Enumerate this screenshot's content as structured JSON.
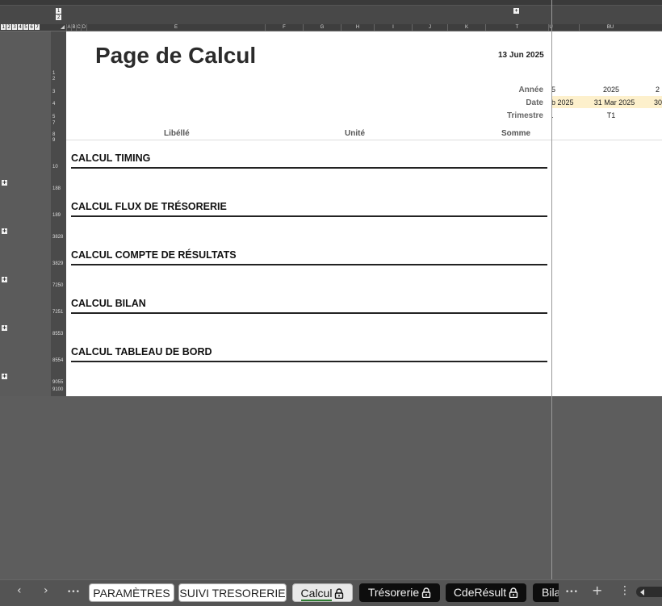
{
  "outline": {
    "top_levels": [
      "1",
      "2"
    ],
    "row_levels": [
      "1",
      "2",
      "3",
      "4",
      "5",
      "6",
      "7"
    ],
    "row_numbers": [
      "1",
      "2",
      "3",
      "4",
      "5",
      "7",
      "8",
      "9",
      "10",
      "188",
      "189",
      "3828",
      "3829",
      "7250",
      "7251",
      "8553",
      "8554",
      "9055",
      "9100"
    ]
  },
  "columns": [
    "A",
    "B",
    "C",
    "D",
    "E",
    "F",
    "G",
    "H",
    "I",
    "J",
    "K",
    "T",
    "U",
    "BU"
  ],
  "sheet": {
    "title": "Page de Calcul",
    "date": "13 Jun 2025",
    "labels": {
      "annee": "Année",
      "date": "Date",
      "trimestre": "Trimestre"
    },
    "headers": {
      "libelle": "Libéllé",
      "unite": "Unité",
      "somme": "Somme"
    },
    "periods": {
      "year_partial": "5",
      "year": "2025",
      "year_next": "2",
      "date_partial": "b 2025",
      "date": "31 Mar 2025",
      "date_next": "30",
      "quarter_partial": ".",
      "quarter": "T1"
    },
    "sections": [
      "CALCUL TIMING",
      "CALCUL FLUX DE TRÉSORERIE",
      "CALCUL COMPTE DE RÉSULTATS",
      "CALCUL BILAN",
      "CALCUL TABLEAU DE BORD"
    ]
  },
  "tabs": {
    "prev": "‹",
    "next": "›",
    "more": "•••",
    "items": [
      {
        "label": "PARAMÈTRES",
        "style": "light"
      },
      {
        "label": "SUIVI TRESORERIE",
        "style": "light"
      },
      {
        "label": "Calcul",
        "style": "active"
      },
      {
        "label": "Trésorerie",
        "style": "dark"
      },
      {
        "label": "CdeRésult",
        "style": "dark"
      },
      {
        "label": "Bila",
        "style": "dark"
      }
    ],
    "overflow": "•••",
    "add": "+",
    "menu": "⋮"
  }
}
